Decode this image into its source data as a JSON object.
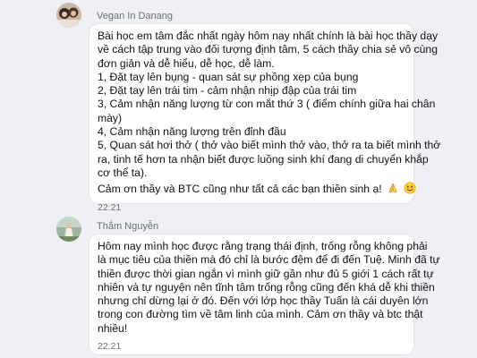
{
  "messages": [
    {
      "sender": "Vegan In Danang",
      "lines": [
        "Bài học em tâm đắc nhất ngày hôm nay nhất chính là bài học thầy dạy",
        "về cách tập trung vào đối tượng định tâm, 5 cách thầy chia sẻ vô cùng",
        "đơn giản và dễ hiểu, dễ học, dễ làm.",
        "1, Đặt tay lên bụng - quan sát sự phồng xẹp của bụng",
        "2, Đặt tay lên trái tim - cảm nhận nhịp đập của trái tim",
        "3, Cảm nhận năng lượng từ con mắt thứ 3 ( điểm chính giữa hai chân",
        "mày)",
        "4, Cảm nhận năng lượng trên đỉnh đầu",
        "5, Quan sát hơi thở ( thở vào biết mình thở vào, thở ra ta biết mình thở",
        "ra, tinh tế hơn ta nhận biết được luồng sinh khí đang di chuyển khắp",
        "cơ thể ta)."
      ],
      "closing": "Cảm ơn thầy và BTC cũng như tất cả các bạn thiền sinh ạ!",
      "emoji_icons": [
        "folded-hands-icon",
        "smiling-face-icon"
      ],
      "time": "22:21"
    },
    {
      "sender": "Thắm Nguyễn",
      "lines": [
        "Hôm nay mình học được rằng trạng thái định, trống rỗng không phải",
        "là mục tiêu của thiền mà đó chỉ là bước đệm để đi đến Tuệ. Minh đã tự",
        "thiền được thời gian ngắn vì mình giữ gần như đủ 5 giới 1 cách rất tự",
        "nhiên và tự nguyện nên tĩnh tâm trống rỗng cũng đến khá dễ khi thiền",
        "nhưng chỉ dừng lại ở đó. Đến với lớp học thầy Tuấn là cái duyên lớn",
        "trong con đường tìm về tâm linh của mình. Cảm ơn thầy và btc thật",
        "nhiều!"
      ],
      "time": "22:21"
    }
  ],
  "colors": {
    "background": "#eef0f4",
    "bubble": "#ffffff",
    "meta_text": "#6b6f76"
  }
}
